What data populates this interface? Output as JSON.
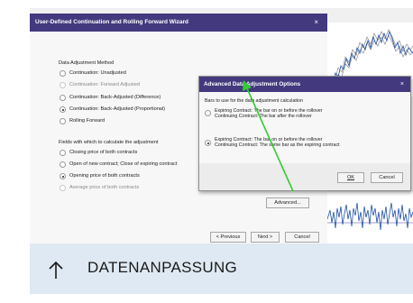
{
  "wizard": {
    "title": "User-Defined Continuation and Rolling Forward Wizard",
    "close": "×",
    "method_heading": "Data Adjustment Method",
    "methods": [
      {
        "label": "Continuation: Unadjusted",
        "selected": false,
        "enabled": true
      },
      {
        "label": "Continuation: Forward Adjusted",
        "selected": false,
        "enabled": false
      },
      {
        "label": "Continuation: Back-Adjusted (Difference)",
        "selected": false,
        "enabled": true
      },
      {
        "label": "Continuation: Back-Adjusted (Proportional)",
        "selected": true,
        "enabled": true
      },
      {
        "label": "Rolling Forward",
        "selected": false,
        "enabled": true
      }
    ],
    "fields_heading": "Fields with which to calculate the adjustment",
    "fields": [
      {
        "label": "Closing price of both contracts",
        "selected": false,
        "enabled": true
      },
      {
        "label": "Open of new contract; Close of expiring contract",
        "selected": false,
        "enabled": true
      },
      {
        "label": "Opening price of both contracts",
        "selected": true,
        "enabled": true
      },
      {
        "label": "Average price of both contracts",
        "selected": false,
        "enabled": false
      }
    ],
    "advanced_button": "Advanced...",
    "previous_button": "< Previous",
    "next_button": "Next >",
    "cancel_button": "Cancel"
  },
  "advanced_dialog": {
    "title": "Advanced Data Adjustment Options",
    "close": "×",
    "prompt": "Bars to use for the data adjustment calculation",
    "options": [
      {
        "line1": "Expiring Contract: The bar on or before the rollover",
        "line2": "Continuing Contract: The bar after the rollover",
        "selected": false
      },
      {
        "line1": "Expiring Contract: The bar on or before the rollover",
        "line2": "Continuing Contract: The same bar as the expiring contract",
        "selected": true
      }
    ],
    "ok_button": "OK",
    "cancel_button": "Cancel"
  },
  "caption": {
    "text": "DATENANPASSUNG"
  },
  "colors": {
    "title_bar": "#43397e",
    "caption_background": "#dfe9f3",
    "annotation_arrow": "#33cc33",
    "chart_line": "#1f4fa8"
  }
}
